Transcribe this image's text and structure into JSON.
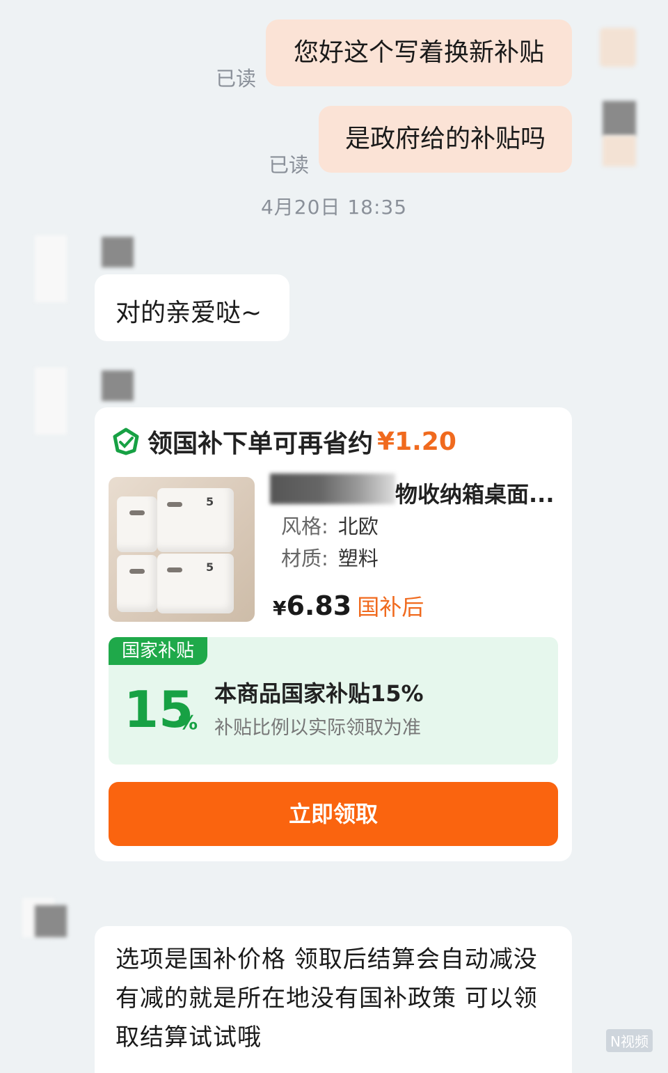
{
  "messages_out": [
    {
      "text": "您好这个写着换新补贴",
      "status": "已读"
    },
    {
      "text": "是政府给的补贴吗",
      "status": "已读"
    }
  ],
  "timestamp": "4月20日 18:35",
  "reply_short": "对的亲爱哒~",
  "card": {
    "header_text": "领国补下单可再省约",
    "header_amount": "¥1.20",
    "product_title": "物收纳箱桌面...",
    "spec_style_label": "风格:",
    "spec_style_value": "北欧",
    "spec_material_label": "材质:",
    "spec_material_value": "塑料",
    "price_currency": "¥",
    "price_value": "6.83",
    "price_tag": "国补后",
    "subsidy_tab": "国家补贴",
    "subsidy_big": "15",
    "subsidy_pct": "%",
    "subsidy_line1": "本商品国家补贴15%",
    "subsidy_line2": "补贴比例以实际领取为准",
    "button_label": "立即领取"
  },
  "reply_long": "选项是国补价格 领取后结算会自动减没有减的就是所在地没有国补政策 可以领取结算试试哦",
  "watermark": "N视频",
  "colors": {
    "outgoing_bubble": "#fbe3d6",
    "accent_orange": "#fa640f",
    "accent_green": "#17a144"
  }
}
